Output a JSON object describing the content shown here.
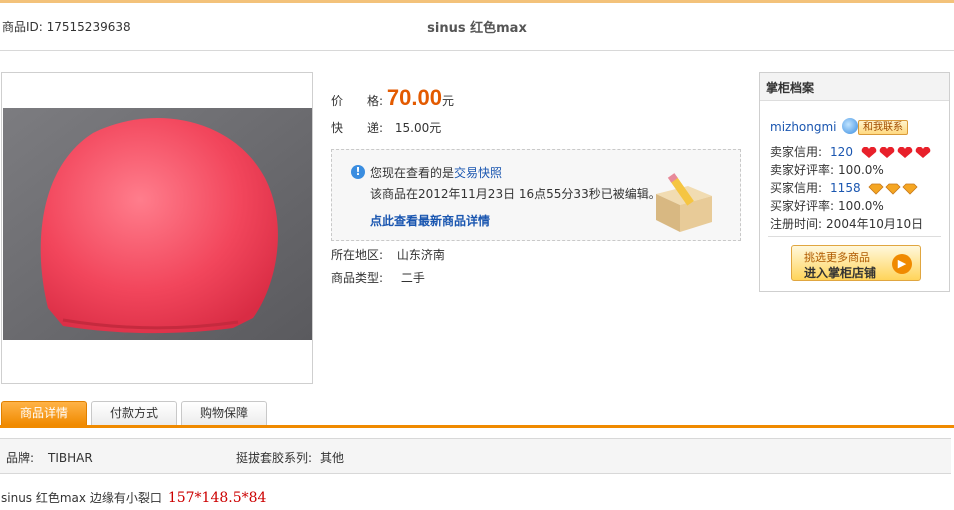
{
  "header": {
    "item_id": "商品ID: 17515239638",
    "title": "sinus 红色max"
  },
  "photo": {
    "alt": "red table tennis rubber sheet"
  },
  "pricing": {
    "price_label": "价　　格:",
    "price_value": "70.00",
    "price_unit": "元",
    "shipping_label": "快　　递:",
    "shipping_value": "15.00元"
  },
  "snapshot": {
    "line1_prefix": "您现在查看的是",
    "line1_link": "交易快照",
    "line2": "该商品在2012年11月23日  16点55分33秒已被编辑。",
    "latest_link": "点此查看最新商品详情"
  },
  "details": {
    "region_label": "所在地区:",
    "region_value": "山东济南",
    "type_label": "商品类型:",
    "type_value": "二手"
  },
  "seller": {
    "heading": "掌柜档案",
    "name": "mizhongmi",
    "contact_label": "和我联系",
    "seller_credit_label": "卖家信用:",
    "seller_credit_value": "120",
    "seller_rating_label": "卖家好评率:",
    "seller_rating_value": "100.0%",
    "buyer_credit_label": "买家信用:",
    "buyer_credit_value": "1158",
    "buyer_rating_label": "买家好评率:",
    "buyer_rating_value": "100.0%",
    "reg_label": "注册时间:",
    "reg_value": "2004年10月10日",
    "shop_line1": "挑选更多商品",
    "shop_line2": "进入掌柜店铺"
  },
  "tabs": [
    {
      "label": "商品详情"
    },
    {
      "label": "付款方式"
    },
    {
      "label": "购物保障"
    }
  ],
  "attributes": {
    "brand_label": "品牌:",
    "brand_value": "TIBHAR",
    "series_label": "挺拔套胶系列:",
    "series_value": "其他"
  },
  "description": {
    "text": "sinus 红色max  边缘有小裂口",
    "size": "157*148.5*84"
  },
  "colors": {
    "accent": "#f08a00",
    "price": "#e35a00",
    "link": "#1a56b0"
  }
}
